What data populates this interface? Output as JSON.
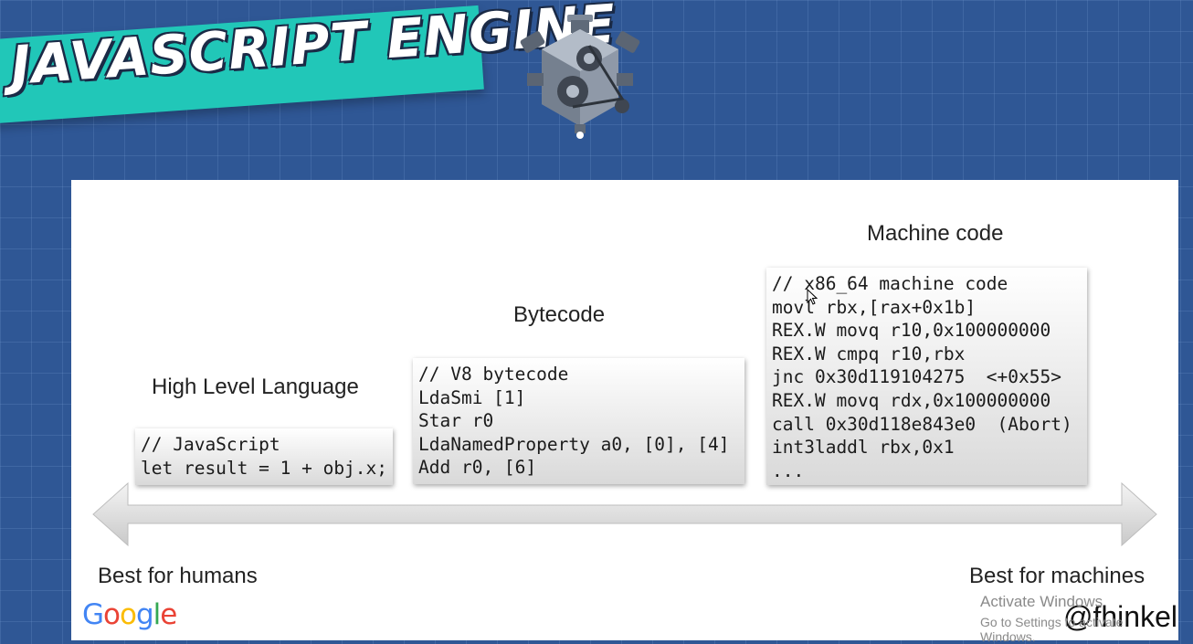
{
  "banner": {
    "title": "JAVASCRIPT ENGINE"
  },
  "headings": {
    "high_level": "High Level Language",
    "bytecode": "Bytecode",
    "machine": "Machine code"
  },
  "code": {
    "javascript": [
      "// JavaScript",
      "let result = 1 + obj.x;"
    ],
    "bytecode": [
      "// V8 bytecode",
      "LdaSmi [1]",
      "Star r0",
      "LdaNamedProperty a0, [0], [4]",
      "Add r0, [6]"
    ],
    "machine": [
      "// x86_64 machine code",
      "movl rbx,[rax+0x1b]",
      "REX.W movq r10,0x100000000",
      "REX.W cmpq r10,rbx",
      "jnc 0x30d119104275  <+0x55>",
      "REX.W movq rdx,0x100000000",
      "call 0x30d118e843e0  (Abort)",
      "int3laddl rbx,0x1",
      "..."
    ]
  },
  "labels": {
    "humans": "Best for humans",
    "machines": "Best for machines"
  },
  "logo": {
    "google": [
      "G",
      "o",
      "o",
      "g",
      "l",
      "e"
    ],
    "colors": [
      "#4285F4",
      "#EA4335",
      "#FBBC05",
      "#4285F4",
      "#34A853",
      "#EA4335"
    ]
  },
  "handle": "@fhinkel",
  "watermark": {
    "title": "Activate Windows",
    "subtitle": "Go to Settings to activate Windows."
  },
  "colors": {
    "background": "#2f5795",
    "banner": "#21c7b8"
  }
}
